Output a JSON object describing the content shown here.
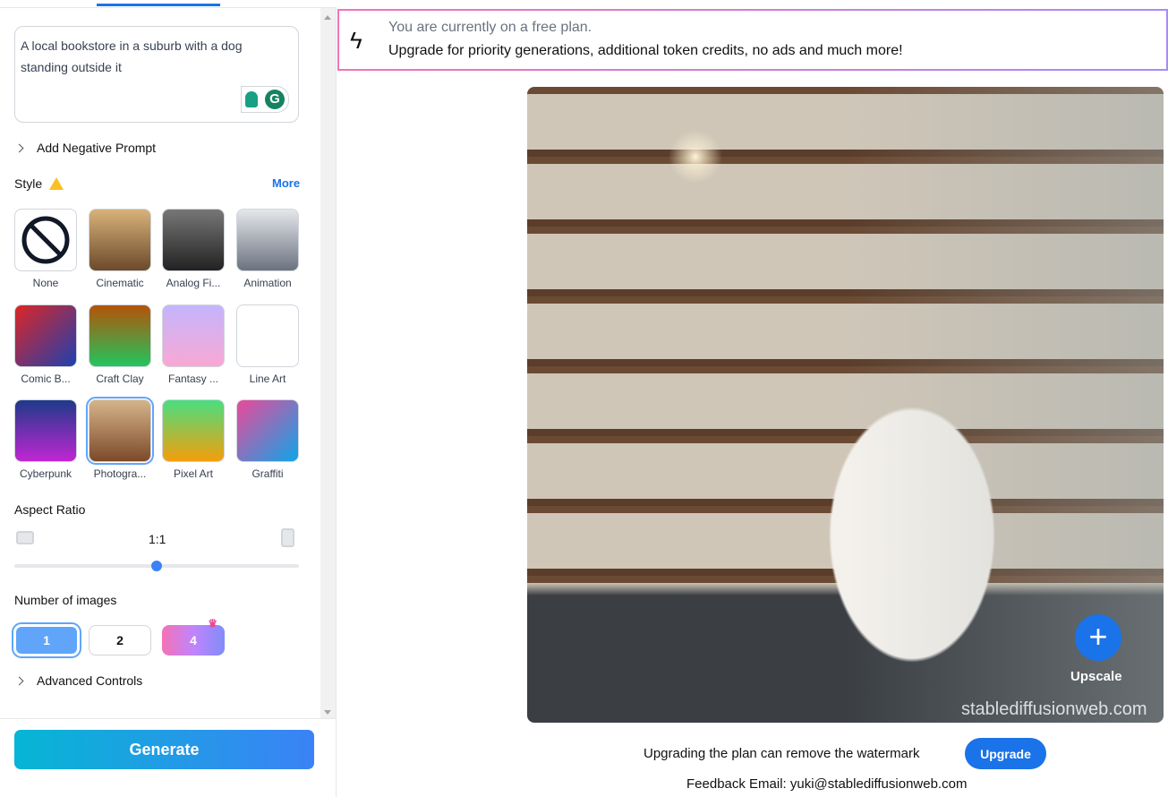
{
  "prompt": {
    "value": "A local bookstore in a suburb with a dog standing outside it"
  },
  "negative_prompt_label": "Add Negative Prompt",
  "style": {
    "label": "Style",
    "more": "More",
    "selected": "Photography",
    "items": [
      {
        "label": "None",
        "icon": "no-icon"
      },
      {
        "label": "Cinematic"
      },
      {
        "label": "Analog Fi..."
      },
      {
        "label": "Animation"
      },
      {
        "label": "Comic B..."
      },
      {
        "label": "Craft Clay"
      },
      {
        "label": "Fantasy ..."
      },
      {
        "label": "Line Art"
      },
      {
        "label": "Cyberpunk"
      },
      {
        "label": "Photogra..."
      },
      {
        "label": "Pixel Art"
      },
      {
        "label": "Graffiti"
      }
    ]
  },
  "aspect": {
    "label": "Aspect Ratio",
    "value": "1:1",
    "slider_percent": 50
  },
  "num_images": {
    "label": "Number of images",
    "options": [
      "1",
      "2",
      "4"
    ],
    "selected": "1"
  },
  "advanced_label": "Advanced Controls",
  "generate_label": "Generate",
  "banner": {
    "line1": "You are currently on a free plan.",
    "line2": "Upgrade for priority generations, additional token credits, no ads and much more!"
  },
  "image": {
    "upscale_label": "Upscale",
    "watermark": "stablediffusionweb.com"
  },
  "footer": {
    "note": "Upgrading the plan can remove the watermark",
    "upgrade": "Upgrade",
    "feedback": "Feedback Email: yuki@stablediffusionweb.com"
  },
  "colors": {
    "accent": "#1a73e8",
    "generate_from": "#06b6d4",
    "generate_to": "#3b82f6"
  }
}
